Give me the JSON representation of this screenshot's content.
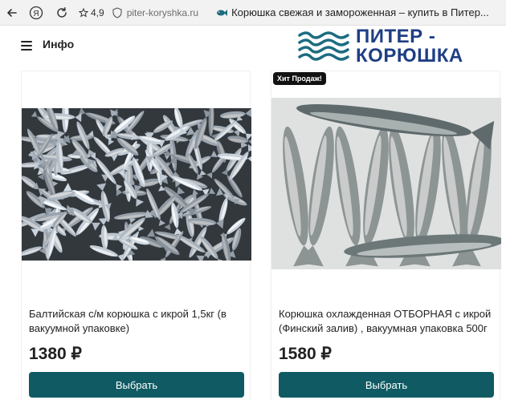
{
  "browser": {
    "rating": "4,9",
    "url": "piter-koryshka.ru",
    "tab_title": "Корюшка свежая и замороженная – купить в Питер..."
  },
  "header": {
    "menu_label": "Инфо",
    "logo_line1": "ПИТЕР -",
    "logo_line2": "КОРЮШКА"
  },
  "products": [
    {
      "name": "Балтийская с/м корюшка с икрой 1,5кг (в вакуумной упаковке)",
      "price": "1380 ₽",
      "button": "Выбрать"
    },
    {
      "badge": "Хит Продаж!",
      "name": "Корюшка охлажденная ОТБОРНАЯ с икрой (Финский залив) , вакуумная упаковка 500г",
      "price": "1580 ₽",
      "button": "Выбрать"
    }
  ],
  "colors": {
    "accent": "#105b63",
    "logo": "#1f3f84"
  }
}
